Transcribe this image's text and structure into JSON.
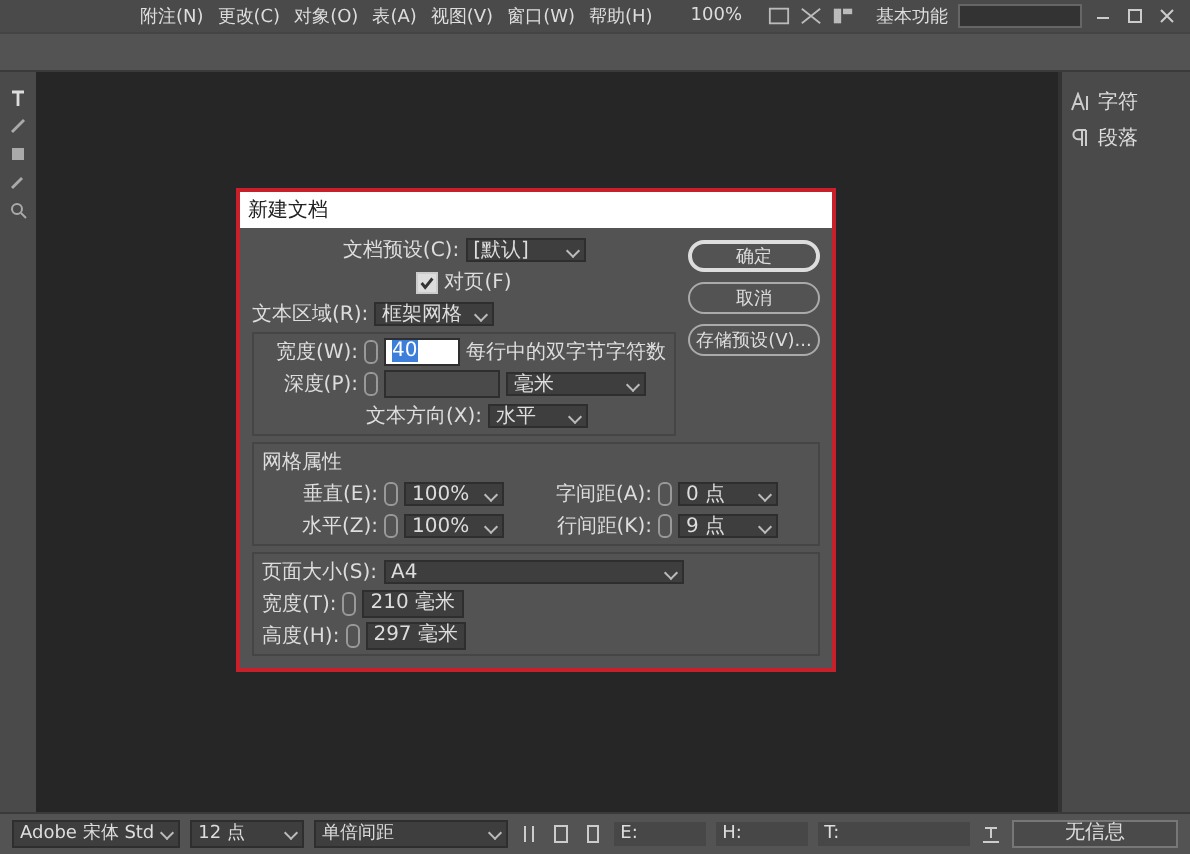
{
  "menu": [
    "附注(N)",
    "更改(C)",
    "对象(O)",
    "表(A)",
    "视图(V)",
    "窗口(W)",
    "帮助(H)"
  ],
  "zoom": "100%",
  "workspace": "基本功能",
  "panels": [
    {
      "kind": "character",
      "label": "字符"
    },
    {
      "kind": "paragraph",
      "label": "段落"
    }
  ],
  "dialog": {
    "title": "新建文档",
    "preset_label": "文档预设(C):",
    "preset": "[默认]",
    "facing_pages": {
      "label": "对页(F)",
      "checked": true
    },
    "text_area_label": "文本区域(R):",
    "text_area": "框架网格",
    "width_label": "宽度(W):",
    "width_value": "40",
    "width_hint": "每行中的双字节字符数",
    "depth_label": "深度(P):",
    "depth_unit": "毫米",
    "direction_label": "文本方向(X):",
    "direction": "水平",
    "grid_title": "网格属性",
    "grid_fields": [
      {
        "label": "垂直(E):",
        "value": "100%"
      },
      {
        "label": "字间距(A):",
        "value": "0 点"
      },
      {
        "label": "水平(Z):",
        "value": "100%"
      },
      {
        "label": "行间距(K):",
        "value": "9 点"
      }
    ],
    "page_size_label": "页面大小(S):",
    "page_size": "A4",
    "page_width_label": "宽度(T):",
    "page_width": "210 毫米",
    "page_height_label": "高度(H):",
    "page_height": "297 毫米",
    "buttons": [
      {
        "label": "确定",
        "selected": true
      },
      {
        "label": "取消",
        "selected": false
      },
      {
        "label": "存储预设(V)...",
        "selected": false
      }
    ]
  },
  "status_bar": {
    "font": "Adobe 宋体 Std",
    "size": "12 点",
    "spacing": "单倍间距",
    "e_label": "E:",
    "h_label": "H:",
    "t_label": "T:",
    "info": "无信息"
  }
}
